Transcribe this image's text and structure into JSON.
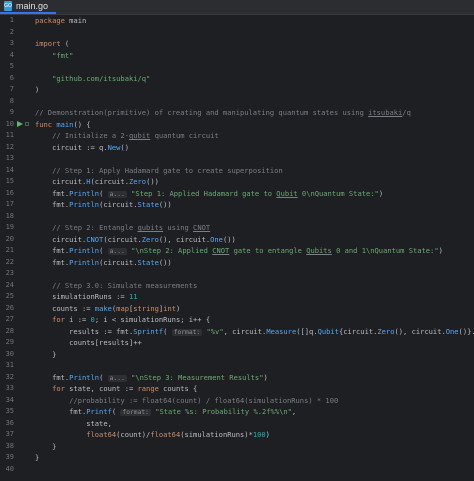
{
  "tab": {
    "label": "main.go",
    "icon": "go-file-icon"
  },
  "lines": [
    {
      "n": "1",
      "code": "<span class=\"kw\">package</span> main"
    },
    {
      "n": "2",
      "code": ""
    },
    {
      "n": "3",
      "code": "<span class=\"kw\">import</span> ("
    },
    {
      "n": "4",
      "code": "    <span class=\"str\">\"fmt\"</span>"
    },
    {
      "n": "5",
      "code": ""
    },
    {
      "n": "6",
      "code": "    <span class=\"str\">\"github.com/itsubaki/q\"</span>"
    },
    {
      "n": "7",
      "code": ")"
    },
    {
      "n": "8",
      "code": ""
    },
    {
      "n": "9",
      "code": "<span class=\"cmt\">// Demonstration(primitive) of creating and manipulating quantum states using <span class=\"ul\">itsubaki</span>/q</span>"
    },
    {
      "n": "10",
      "code": "<span class=\"kw\">func</span> <span class=\"fn\">main</span>() {",
      "run": true
    },
    {
      "n": "11",
      "code": "    <span class=\"cmt\">// Initialize a 2-<span class=\"ul\">qubit</span> quantum circuit</span>"
    },
    {
      "n": "12",
      "code": "    circuit := q.<span class=\"fn\">New</span>()"
    },
    {
      "n": "13",
      "code": ""
    },
    {
      "n": "14",
      "code": "    <span class=\"cmt\">// Step 1: Apply Hadamard gate to create superposition</span>"
    },
    {
      "n": "15",
      "code": "    circuit.<span class=\"fn\">H</span>(circuit.<span class=\"fn\">Zero</span>())"
    },
    {
      "n": "16",
      "code": "    fmt.<span class=\"fn\">Println</span>( <span class=\"hint\">a...</span> <span class=\"str\">\"Step 1: Applied Hadamard gate to <span class=\"ul\">Qubit</span> 0\\nQuantum State:\"</span>)"
    },
    {
      "n": "17",
      "code": "    fmt.<span class=\"fn\">Println</span>(circuit.<span class=\"fn\">State</span>())"
    },
    {
      "n": "18",
      "code": ""
    },
    {
      "n": "19",
      "code": "    <span class=\"cmt\">// Step 2: Entangle <span class=\"ul\">qubits</span> using <span class=\"ul\">CNOT</span></span>"
    },
    {
      "n": "20",
      "code": "    circuit.<span class=\"fn\">CNOT</span>(circuit.<span class=\"fn\">Zero</span>(), circuit.<span class=\"fn\">One</span>())"
    },
    {
      "n": "21",
      "code": "    fmt.<span class=\"fn\">Println</span>( <span class=\"hint\">a...</span> <span class=\"str\">\"\\nStep 2: Applied <span class=\"ul\">CNOT</span> gate to entangle <span class=\"ul\">Qubits</span> 0 and 1\\nQuantum State:\"</span>)"
    },
    {
      "n": "22",
      "code": "    fmt.<span class=\"fn\">Println</span>(circuit.<span class=\"fn\">State</span>())"
    },
    {
      "n": "23",
      "code": ""
    },
    {
      "n": "24",
      "code": "    <span class=\"cmt\">// Step 3.0: Simulate measurements</span>"
    },
    {
      "n": "25",
      "code": "    simulationRuns := <span class=\"num\">11</span>"
    },
    {
      "n": "26",
      "code": "    counts := <span class=\"fn\">make</span>(<span class=\"kw\">map</span>[<span class=\"kw\">string</span>]<span class=\"kw\">int</span>)"
    },
    {
      "n": "27",
      "code": "    <span class=\"kw\">for</span> i := <span class=\"num\">0</span>; i &lt; simulationRuns; i++ {"
    },
    {
      "n": "28",
      "code": "        results := fmt.<span class=\"fn\">Sprintf</span>( <span class=\"hint\">format:</span> <span class=\"str\">\"%v\"</span>, circuit.<span class=\"fn\">Measure</span>([]q.<span class=\"fn\">Qubit</span>{circuit.<span class=\"fn\">Zero</span>(), circuit.<span class=\"fn\">One</span>()}...))"
    },
    {
      "n": "29",
      "code": "        counts[results]++"
    },
    {
      "n": "30",
      "code": "    }"
    },
    {
      "n": "31",
      "code": ""
    },
    {
      "n": "32",
      "code": "    fmt.<span class=\"fn\">Println</span>( <span class=\"hint\">a...</span> <span class=\"str\">\"\\nStep 3: Measurement Results\"</span>)"
    },
    {
      "n": "33",
      "code": "    <span class=\"kw\">for</span> state, count := <span class=\"kw\">range</span> counts {"
    },
    {
      "n": "34",
      "code": "        <span class=\"cmt\">//probability := float64(count) / float64(simulationRuns) * 100</span>"
    },
    {
      "n": "35",
      "code": "        fmt.<span class=\"fn\">Printf</span>( <span class=\"hint\">format:</span> <span class=\"str\">\"State %s: Probability %.2f%%\\n\"</span>,"
    },
    {
      "n": "36",
      "code": "            state,"
    },
    {
      "n": "37",
      "code": "            <span class=\"kw\">float64</span>(count)/<span class=\"kw\">float64</span>(simulationRuns)*<span class=\"num\">100</span>)"
    },
    {
      "n": "38",
      "code": "    }"
    },
    {
      "n": "39",
      "code": "}"
    },
    {
      "n": "40",
      "code": ""
    }
  ]
}
